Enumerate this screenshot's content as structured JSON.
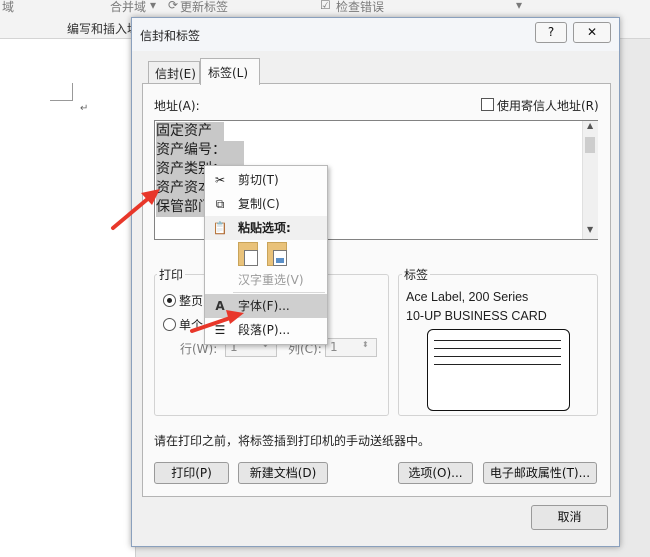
{
  "ribbon": {
    "item_left": "域",
    "merge_field": "合并域",
    "update_labels": "更新标签",
    "check_errors": "检查错误",
    "group_label": "编写和插入域"
  },
  "dialog": {
    "title": "信封和标签",
    "help": "?",
    "close": "✕",
    "tabs": {
      "envelope": "信封(E)",
      "labels": "标签(L)"
    },
    "address_label": "地址(A):",
    "use_return_address": "使用寄信人地址(R)",
    "address_lines": [
      "固定资产",
      "资产编号：",
      "资产类别：",
      "资产资本：",
      "保管部门："
    ],
    "print_group": {
      "title": "打印",
      "full_page": "整页",
      "single": "单个",
      "row_label": "行(W):",
      "row_value": "1",
      "col_label": "列(C):",
      "col_value": "1"
    },
    "label_group": {
      "title": "标签",
      "line1": "Ace Label, 200 Series",
      "line2": "10-UP BUSINESS CARD"
    },
    "hint": "请在打印之前，将标签插到打印机的手动送纸器中。",
    "buttons": {
      "print": "打印(P)",
      "new_doc": "新建文档(D)",
      "options": "选项(O)...",
      "epostage": "电子邮政属性(T)...",
      "cancel": "取消"
    }
  },
  "context_menu": {
    "cut": "剪切(T)",
    "copy": "复制(C)",
    "paste_options": "粘贴选项:",
    "reconvert": "汉字重选(V)",
    "font": "字体(F)...",
    "paragraph": "段落(P)..."
  },
  "colors": {
    "selection": "#c8c8c8",
    "arrow": "#e8372a",
    "hover": "#cde3f7"
  }
}
